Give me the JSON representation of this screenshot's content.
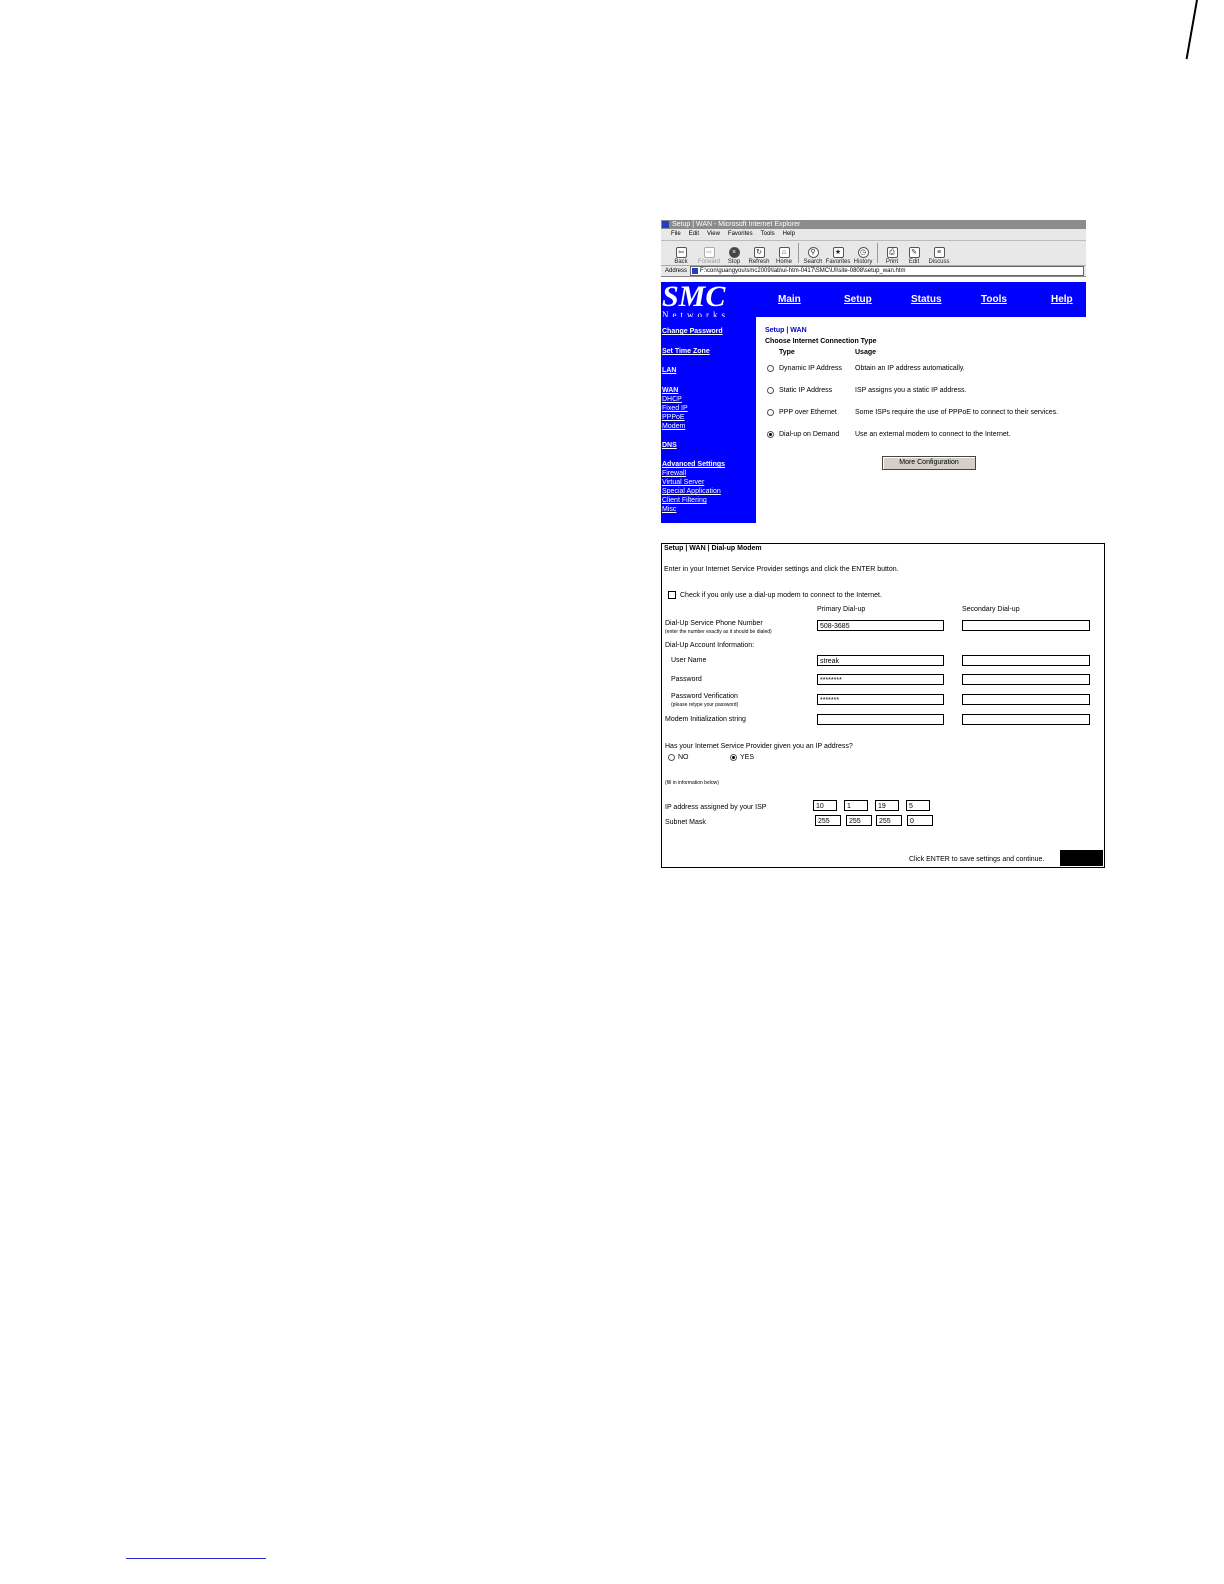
{
  "browser": {
    "title": "Setup | WAN - Microsoft Internet Explorer",
    "menu": [
      "File",
      "Edit",
      "View",
      "Favorites",
      "Tools",
      "Help"
    ],
    "toolbar": [
      "Back",
      "Forward",
      "Stop",
      "Refresh",
      "Home",
      "Search",
      "Favorites",
      "History",
      "Print",
      "Edit",
      "Discuss"
    ],
    "address_label": "Address",
    "address_value": "F:\\con\\guangyou\\smc2009\\lab\\ui-htm-0417\\SMC\\UI\\site-0808\\setup_wan.htm"
  },
  "logo": {
    "main": "SMC",
    "sub": "Networks"
  },
  "topnav": [
    "Main",
    "Setup",
    "Status",
    "Tools",
    "Help"
  ],
  "sidebar": {
    "change_password": "Change  Password",
    "set_time_zone": "Set Time Zone",
    "lan": "LAN",
    "wan": "WAN",
    "wan_sub": [
      "DHCP",
      "Fixed IP",
      "PPPoE",
      "Modem"
    ],
    "dns": "DNS",
    "advanced": "Advanced Settings",
    "advanced_sub": [
      "Firewall",
      "Virtual Server",
      "Special Application",
      "Client Filtering",
      "Misc"
    ]
  },
  "wan": {
    "breadcrumb": "Setup | WAN",
    "heading": "Choose Internet Connection Type",
    "col_type": "Type",
    "col_usage": "Usage",
    "options": [
      {
        "type": "Dynamic IP Address",
        "usage": "Obtain an IP address automatically.",
        "selected": false
      },
      {
        "type": "Static IP Address",
        "usage": "ISP assigns you a static IP address.",
        "selected": false
      },
      {
        "type": "PPP over Ethernet",
        "usage": "Some ISPs require the use of PPPoE to connect to their services.",
        "selected": false
      },
      {
        "type": "Dial-up on Demand",
        "usage": "Use an external modem to connect to the Internet.",
        "selected": true
      }
    ],
    "more_button": "More Configuration"
  },
  "dialup": {
    "title": "Setup | WAN | Dial-up Modem",
    "intro": "Enter in your Internet Service Provider settings and click the ENTER button.",
    "only_dialup_label": "Check if you only use a dial-up modem to connect to the Internet.",
    "col_primary": "Primary Dial-up",
    "col_secondary": "Secondary Dial-up",
    "phone_label": "Dial-Up Service Phone Number",
    "phone_hint": "(enter the number exactly as it should be dialed)",
    "phone_primary": "508-3685",
    "phone_secondary": "",
    "account_label": "Dial-Up Account Information:",
    "username_label": "User Name",
    "username_primary": "streak",
    "username_secondary": "",
    "password_label": "Password",
    "password_primary": "********",
    "password_secondary": "",
    "verify_label": "Password Verification",
    "verify_hint": "(please retype your password)",
    "verify_primary": "*******",
    "verify_secondary": "",
    "init_label": "Modem Initialization string",
    "init_primary": "",
    "init_secondary": "",
    "ip_question": "Has your Internet Service Provider given you an IP address?",
    "no_label": "NO",
    "yes_label": "YES",
    "yes_selected": true,
    "fill_hint": "(fill in information below)",
    "ip_label": "IP address assigned by your ISP",
    "ip_octets": [
      "10",
      "1",
      "19",
      "5"
    ],
    "mask_label": "Subnet Mask",
    "mask_octets": [
      "255",
      "255",
      "255",
      "0"
    ],
    "enter_hint": "Click ENTER to save settings and continue."
  }
}
